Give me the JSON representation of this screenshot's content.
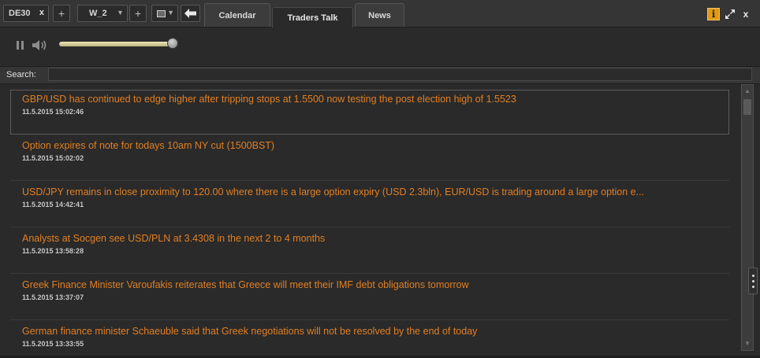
{
  "toolbar": {
    "instrument": "DE30",
    "instrument_close": "x",
    "add_label": "+",
    "workspace": "W_2",
    "add_label_2": "+",
    "monitor_icon": "monitor-icon",
    "back_icon": "arrow-left-icon"
  },
  "tabs": [
    {
      "label": "Calendar",
      "active": false
    },
    {
      "label": "Traders Talk",
      "active": true
    },
    {
      "label": "News",
      "active": false
    }
  ],
  "window_controls": {
    "info_label": "i",
    "expand_icon": "expand-icon",
    "close_label": "x"
  },
  "audio": {
    "pause_icon": "pause-icon",
    "speaker_icon": "speaker-icon",
    "volume": 1.0,
    "slider_color": "#d9d29a"
  },
  "search": {
    "label": "Search:",
    "value": "",
    "placeholder": ""
  },
  "colors": {
    "headline": "#e07f23",
    "background": "#2a2a2a",
    "accent": "#e19a17"
  },
  "news": [
    {
      "headline": "GBP/USD has continued to edge higher after tripping stops at 1.5500 now testing the post election high of 1.5523",
      "time": "11.5.2015 15:02:46",
      "selected": true
    },
    {
      "headline": "Option expires of note for todays 10am NY cut (1500BST)",
      "time": "11.5.2015 15:02:02",
      "selected": false
    },
    {
      "headline": "USD/JPY remains in close proximity to 120.00 where there is a large option expiry (USD 2.3bln), EUR/USD is trading around a large option e...",
      "time": "11.5.2015 14:42:41",
      "selected": false
    },
    {
      "headline": "Analysts at Socgen see USD/PLN at 3.4308 in the next 2 to 4 months",
      "time": "11.5.2015 13:58:28",
      "selected": false
    },
    {
      "headline": "Greek Finance Minister Varoufakis reiterates that Greece will meet their IMF debt obligations tomorrow",
      "time": "11.5.2015 13:37:07",
      "selected": false
    },
    {
      "headline": "German finance minister Schaeuble said that Greek negotiations will not be resolved by the end of today",
      "time": "11.5.2015 13:33:55",
      "selected": false
    }
  ],
  "scrollbar": {
    "position": 0.0
  }
}
